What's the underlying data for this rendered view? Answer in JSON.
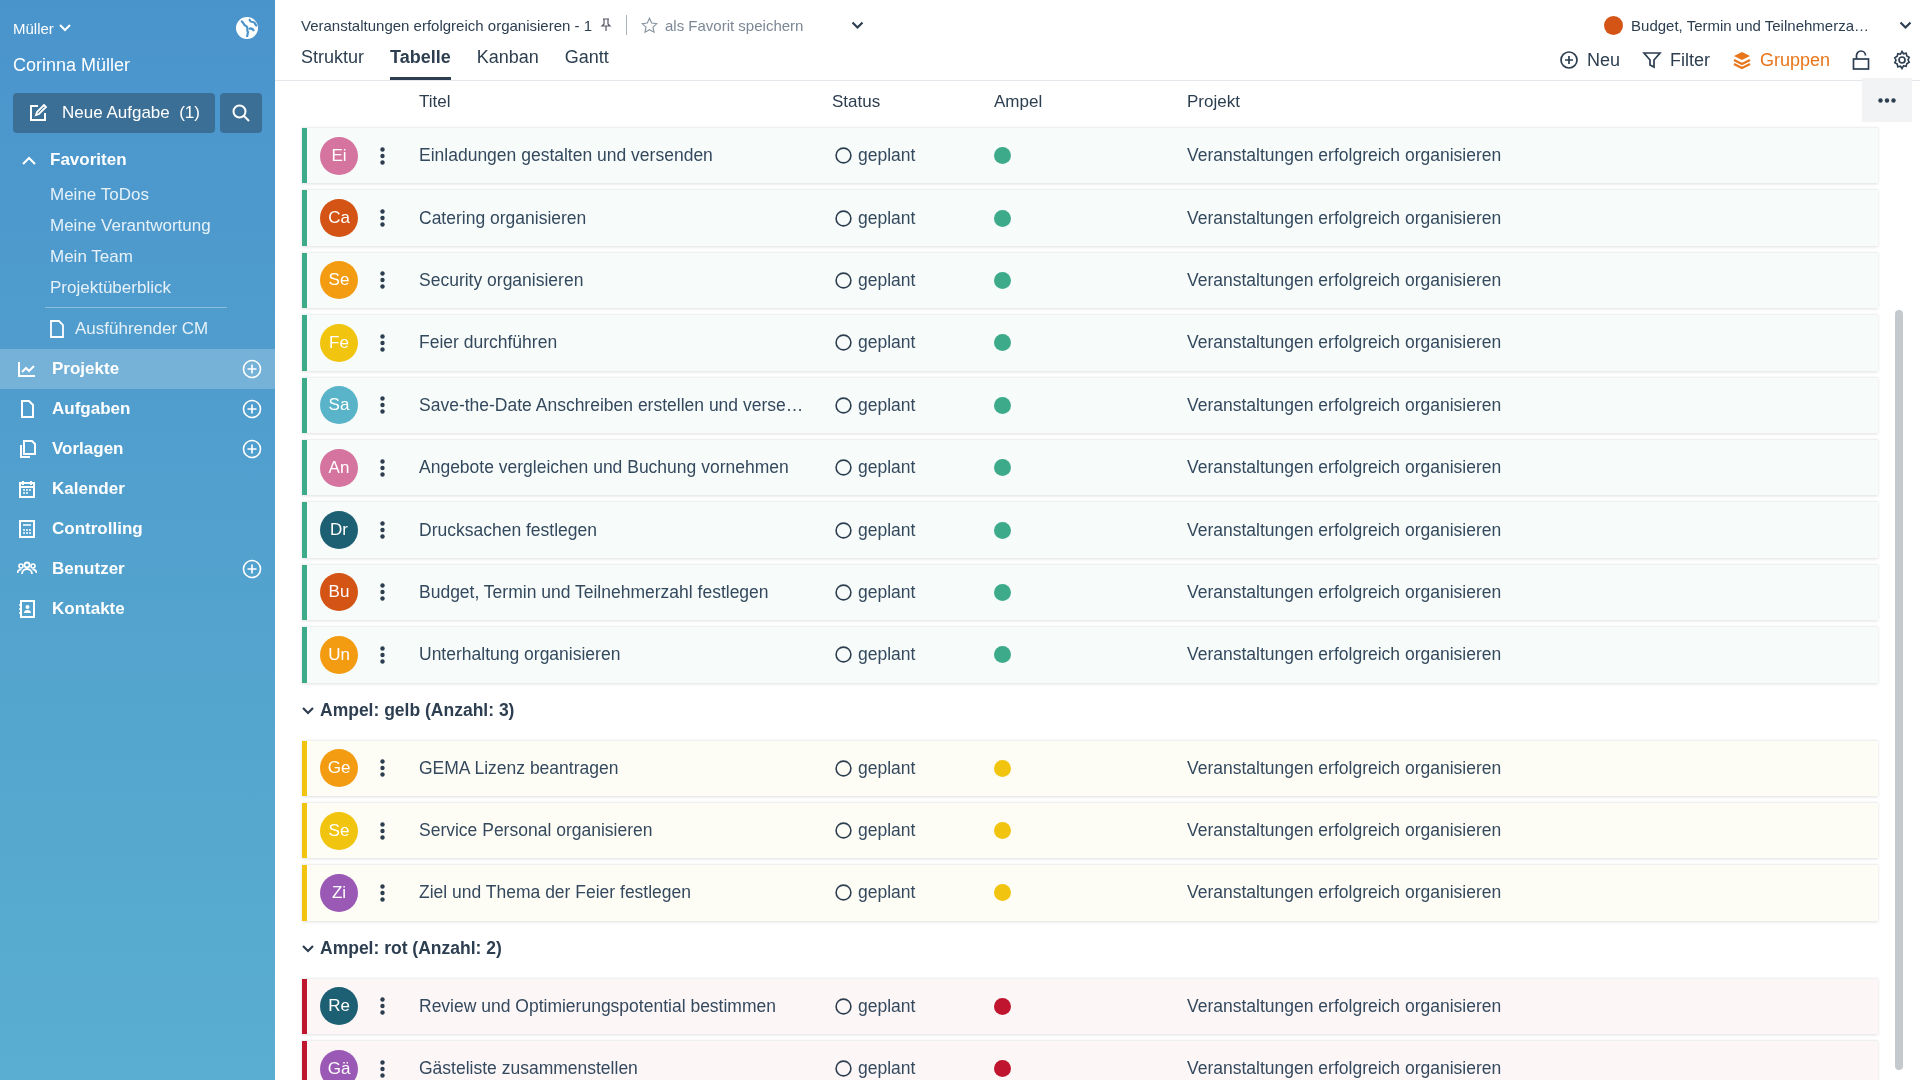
{
  "sidebar": {
    "account": "Müller",
    "user": "Corinna Müller",
    "new_task_button": "Neue Aufgabe  (1)",
    "favorites": {
      "label": "Favoriten",
      "expanded": true,
      "items": [
        "Meine ToDos",
        "Meine Verantwortung",
        "Mein Team",
        "Projektüberblick"
      ],
      "saved": [
        "Ausführender CM"
      ]
    },
    "nav": [
      {
        "label": "Projekte",
        "selected": true,
        "add": true
      },
      {
        "label": "Aufgaben",
        "selected": false,
        "add": true
      },
      {
        "label": "Vorlagen",
        "selected": false,
        "add": true
      },
      {
        "label": "Kalender",
        "selected": false,
        "add": false
      },
      {
        "label": "Controlling",
        "selected": false,
        "add": false
      },
      {
        "label": "Benutzer",
        "selected": false,
        "add": true
      },
      {
        "label": "Kontakte",
        "selected": false,
        "add": false
      }
    ]
  },
  "header": {
    "view_title": "Veranstaltungen erfolgreich organisieren - 1",
    "favorite_button": "als Favorit speichern",
    "context": {
      "label": "Budget, Termin und Teilnehmerza…",
      "color": "#d35414"
    },
    "tabs": [
      {
        "label": "Struktur",
        "selected": false
      },
      {
        "label": "Tabelle",
        "selected": true
      },
      {
        "label": "Kanban",
        "selected": false
      },
      {
        "label": "Gantt",
        "selected": false
      }
    ],
    "toolbar": [
      {
        "label": "Neu",
        "active": false
      },
      {
        "label": "Filter",
        "active": false
      },
      {
        "label": "Gruppen",
        "active": true
      }
    ]
  },
  "table": {
    "columns": [
      "Titel",
      "Status",
      "Ampel",
      "Projekt"
    ],
    "groups": [
      {
        "color": "#3daa8a",
        "rows": [
          {
            "initials": "Ei",
            "color": "#d4749f",
            "title": "Einladungen gestalten und versenden",
            "status": "geplant",
            "project": "Veranstaltungen erfolgreich organisieren"
          },
          {
            "initials": "Ca",
            "color": "#d35414",
            "title": "Catering organisieren",
            "status": "geplant",
            "project": "Veranstaltungen erfolgreich organisieren"
          },
          {
            "initials": "Se",
            "color": "#f39c12",
            "title": "Security organisieren",
            "status": "geplant",
            "project": "Veranstaltungen erfolgreich organisieren"
          },
          {
            "initials": "Fe",
            "color": "#f1c40f",
            "title": "Feier durchführen",
            "status": "geplant",
            "project": "Veranstaltungen erfolgreich organisieren"
          },
          {
            "initials": "Sa",
            "color": "#5ab4c9",
            "title": "Save-the-Date Anschreiben erstellen und verse…",
            "status": "geplant",
            "project": "Veranstaltungen erfolgreich organisieren"
          },
          {
            "initials": "An",
            "color": "#d4749f",
            "title": "Angebote vergleichen und Buchung vornehmen",
            "status": "geplant",
            "project": "Veranstaltungen erfolgreich organisieren"
          },
          {
            "initials": "Dr",
            "color": "#1d5f73",
            "title": "Drucksachen festlegen",
            "status": "geplant",
            "project": "Veranstaltungen erfolgreich organisieren"
          },
          {
            "initials": "Bu",
            "color": "#d35414",
            "title": "Budget, Termin und Teilnehmerzahl festlegen",
            "status": "geplant",
            "project": "Veranstaltungen erfolgreich organisieren"
          },
          {
            "initials": "Un",
            "color": "#f39c12",
            "title": "Unterhaltung organisieren",
            "status": "geplant",
            "project": "Veranstaltungen erfolgreich organisieren"
          }
        ]
      },
      {
        "heading": "Ampel: gelb (Anzahl: 3)",
        "expanded": true,
        "color": "#f1c40f",
        "rows": [
          {
            "initials": "Ge",
            "color": "#f39c12",
            "title": "GEMA Lizenz beantragen",
            "status": "geplant",
            "project": "Veranstaltungen erfolgreich organisieren"
          },
          {
            "initials": "Se",
            "color": "#f1c40f",
            "title": "Service Personal organisieren",
            "status": "geplant",
            "project": "Veranstaltungen erfolgreich organisieren"
          },
          {
            "initials": "Zi",
            "color": "#9b59b6",
            "title": "Ziel und Thema der Feier festlegen",
            "status": "geplant",
            "project": "Veranstaltungen erfolgreich organisieren"
          }
        ]
      },
      {
        "heading": "Ampel: rot (Anzahl: 2)",
        "expanded": true,
        "color": "#c0152f",
        "rows": [
          {
            "initials": "Re",
            "color": "#1d5f73",
            "title": "Review und Optimierungspotential bestimmen",
            "status": "geplant",
            "project": "Veranstaltungen erfolgreich organisieren"
          },
          {
            "initials": "Gä",
            "color": "#9b59b6",
            "title": "Gästeliste zusammenstellen",
            "status": "geplant",
            "project": "Veranstaltungen erfolgreich organisieren"
          }
        ]
      }
    ]
  }
}
